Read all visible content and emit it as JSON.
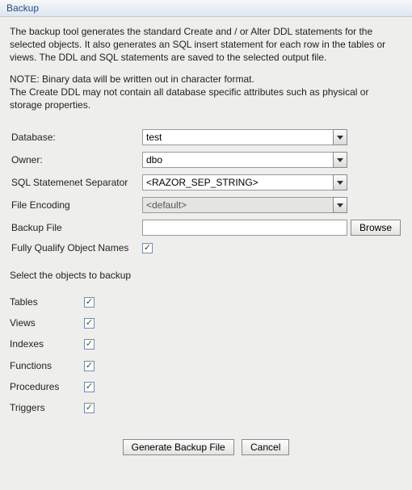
{
  "window": {
    "title": "Backup"
  },
  "description": "The backup tool generates the standard Create and / or Alter DDL statements for the selected objects. It also generates an SQL insert statement for each row in the tables or views. The DDL and SQL statements are saved to the selected output file.",
  "note": "NOTE: Binary data will be written out in character format.\nThe Create DDL may not contain all database specific attributes such as physical or storage properties.",
  "form": {
    "database": {
      "label": "Database:",
      "value": "test"
    },
    "owner": {
      "label": "Owner:",
      "value": "dbo"
    },
    "separator": {
      "label": "SQL Statemenet Separator",
      "value": "<RAZOR_SEP_STRING>"
    },
    "encoding": {
      "label": "File Encoding",
      "value": "<default>"
    },
    "backup_file": {
      "label": "Backup File",
      "value": ""
    },
    "browse_label": "Browse",
    "fully_qualify": {
      "label": "Fully Qualify Object Names",
      "checked": true
    }
  },
  "objects_section_label": "Select the objects to backup",
  "objects": [
    {
      "label": "Tables",
      "checked": true
    },
    {
      "label": "Views",
      "checked": true
    },
    {
      "label": "Indexes",
      "checked": true
    },
    {
      "label": "Functions",
      "checked": true
    },
    {
      "label": "Procedures",
      "checked": true
    },
    {
      "label": "Triggers",
      "checked": true
    }
  ],
  "buttons": {
    "generate": "Generate Backup File",
    "cancel": "Cancel"
  },
  "check_mark": "✓"
}
